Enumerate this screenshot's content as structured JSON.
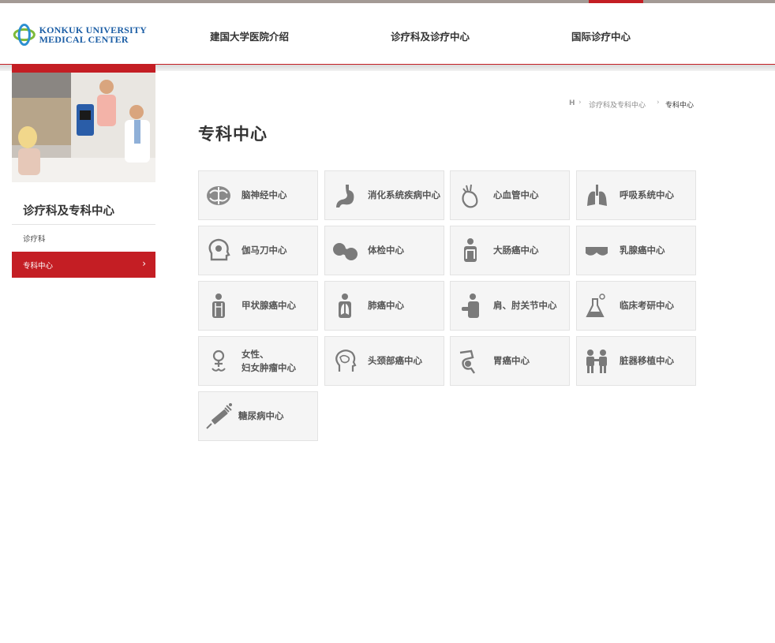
{
  "header": {
    "logo_line1": "KONKUK UNIVERSITY",
    "logo_line2": "MEDICAL CENTER",
    "nav": [
      "建国大学医院介绍",
      "诊疗科及诊疗中心",
      "国际诊疗中心"
    ]
  },
  "sidebar": {
    "title": "诊疗科及专科中心",
    "items": [
      {
        "label": "诊疗科",
        "active": false
      },
      {
        "label": "专科中心",
        "active": true
      }
    ],
    "arrow": "›"
  },
  "breadcrumb": {
    "home": "H",
    "sep": "›",
    "level1": "诊疗科及专科中心",
    "level2": "专科中心"
  },
  "page": {
    "title": "专科中心"
  },
  "tiles": [
    {
      "label": "脑神经中心",
      "icon": "brain-icon"
    },
    {
      "label": "消化系统疾病中心",
      "icon": "stomach-icon"
    },
    {
      "label": "心血管中心",
      "icon": "heart-icon"
    },
    {
      "label": "呼吸系统中心",
      "icon": "lungs-icon"
    },
    {
      "label": "伽马刀中心",
      "icon": "head-icon"
    },
    {
      "label": "体检中心",
      "icon": "capsule-icon"
    },
    {
      "label": "大肠癌中心",
      "icon": "colon-icon"
    },
    {
      "label": "乳腺癌中心",
      "icon": "bra-icon"
    },
    {
      "label": "甲状腺癌中心",
      "icon": "thyroid-icon"
    },
    {
      "label": "肺癌中心",
      "icon": "lung-body-icon"
    },
    {
      "label": "肩、肘关节中心",
      "icon": "shoulder-icon"
    },
    {
      "label": "临床考研中心",
      "icon": "flask-icon"
    },
    {
      "label": "女性、",
      "label2": "妇女肿瘤中心",
      "icon": "female-icon"
    },
    {
      "label": "头颈部癌中心",
      "icon": "head-brain-icon"
    },
    {
      "label": "胃癌中心",
      "icon": "gastric-icon"
    },
    {
      "label": "脏器移植中心",
      "icon": "people-icon"
    },
    {
      "label": "糖尿病中心",
      "icon": "syringe-icon"
    }
  ],
  "colors": {
    "accent": "#c41e24",
    "tile_bg": "#f5f5f5",
    "icon": "#7a7a7a",
    "logo_blue": "#1d5fa6",
    "logo_green": "#7dbb3a"
  }
}
